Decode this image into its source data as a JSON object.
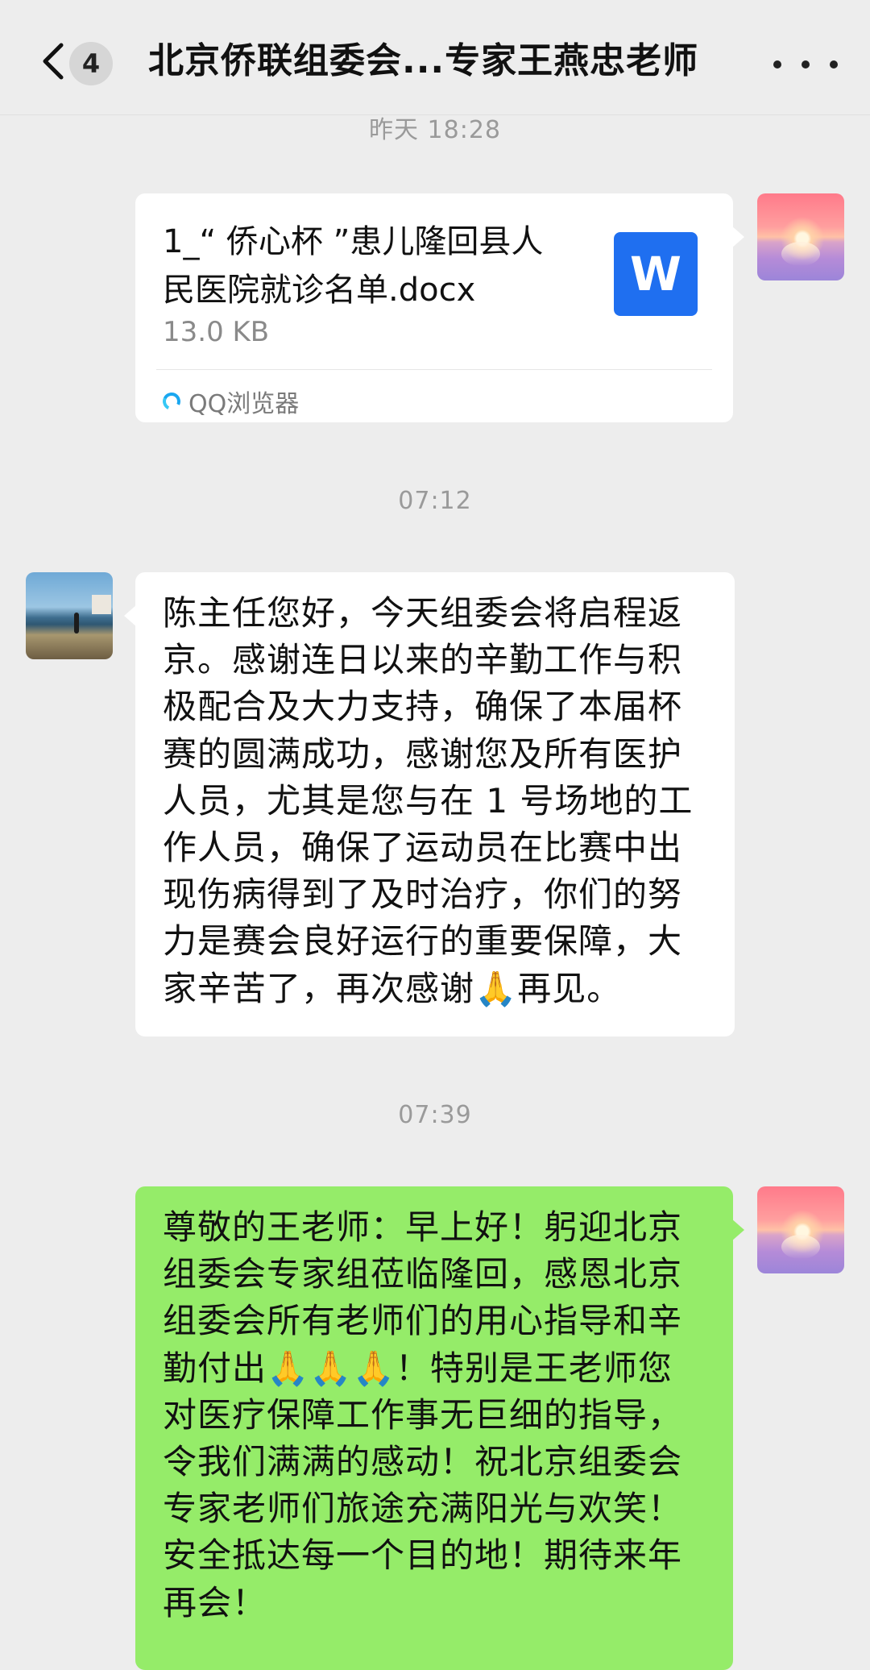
{
  "header": {
    "back_icon": "chevron-left-icon",
    "unread_count": "4",
    "title": "北京侨联组委会...专家王燕忠老师",
    "more_icon": "more-dots-icon"
  },
  "messages": [
    {
      "timestamp": "昨天 18:28",
      "side": "right",
      "type": "file",
      "file_name_line1": "1_“ 侨心杯 ”患儿隆回县人",
      "file_name_line2": "民医院就诊名单.docx",
      "file_size": "13.0 KB",
      "file_icon": "W",
      "source": "QQ浏览器",
      "avatar": "sunset-avatar"
    },
    {
      "timestamp": "07:12",
      "side": "left",
      "type": "text",
      "avatar": "beach-avatar",
      "lines": [
        "陈主任您好，今天组委会将启程返",
        "京。感谢连日以来的辛勤工作与积",
        "极配合及大力支持，确保了本届杯",
        "赛的圆满成功，感谢您及所有医护",
        "人员，尤其是您与在 1 号场地的工",
        "作人员，确保了运动员在比赛中出",
        "现伤病得到了及时治疗，你们的努",
        "力是赛会良好运行的重要保障，大",
        "家辛苦了，再次感谢🙏再见。"
      ]
    },
    {
      "timestamp": "07:39",
      "side": "right",
      "type": "text",
      "avatar": "sunset-avatar",
      "lines": [
        "尊敬的王老师：早上好！躬迎北京",
        "组委会专家组莅临隆回，感恩北京",
        "组委会所有老师们的用心指导和辛",
        "勤付出🙏🙏🙏！特别是王老师您",
        "对医疗保障工作事无巨细的指导，",
        "令我们满满的感动！祝北京组委会",
        "专家老师们旅途充满阳光与欢笑！",
        "安全抵达每一个目的地！期待来年",
        "再会！"
      ]
    }
  ],
  "colors": {
    "background": "#ededed",
    "bubble_white": "#ffffff",
    "bubble_green": "#95ec69",
    "word_blue": "#1f6ff0",
    "timestamp": "#9a9a9a"
  }
}
